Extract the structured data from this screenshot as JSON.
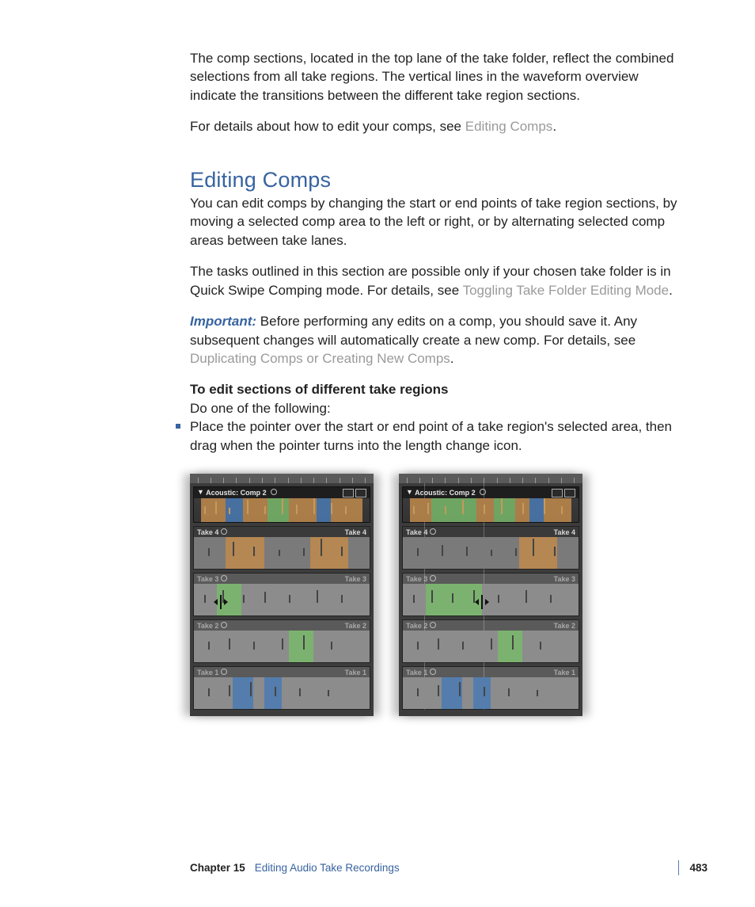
{
  "intro": {
    "p1": "The comp sections, located in the top lane of the take folder, reflect the combined selections from all take regions. The vertical lines in the waveform overview indicate the transitions between the different take region sections.",
    "p2a": "For details about how to edit your comps, see ",
    "p2link": "Editing Comps",
    "p2b": "."
  },
  "section": {
    "heading": "Editing Comps",
    "p1": "You can edit comps by changing the start or end points of take region sections, by moving a selected comp area to the left or right, or by alternating selected comp areas between take lanes.",
    "p2a": "The tasks outlined in this section are possible only if your chosen take folder is in Quick Swipe Comping mode. For details, see ",
    "p2link": "Toggling Take Folder Editing Mode",
    "p2b": ".",
    "important_label": "Important:",
    "important_a": "  Before performing any edits on a comp, you should save it. Any subsequent changes will automatically create a new comp. For details, see ",
    "important_link": "Duplicating Comps or Creating New Comps",
    "important_b": ".",
    "task_heading": "To edit sections of different take regions",
    "task_sub": "Do one of the following:",
    "bullet1": "Place the pointer over the start or end point of a take region's selected area, then drag when the pointer turns into the length change icon."
  },
  "screenshot": {
    "comp_title": "Acoustic: Comp 2",
    "takes": [
      {
        "left_label": "Take 4",
        "right_label": "Take 4"
      },
      {
        "left_label": "Take 3",
        "right_label": "Take 3"
      },
      {
        "left_label": "Take 2",
        "right_label": "Take 2"
      },
      {
        "left_label": "Take 1",
        "right_label": "Take 1"
      }
    ]
  },
  "footer": {
    "chapter": "Chapter 15",
    "title": "Editing Audio Take Recordings",
    "page": "483"
  }
}
